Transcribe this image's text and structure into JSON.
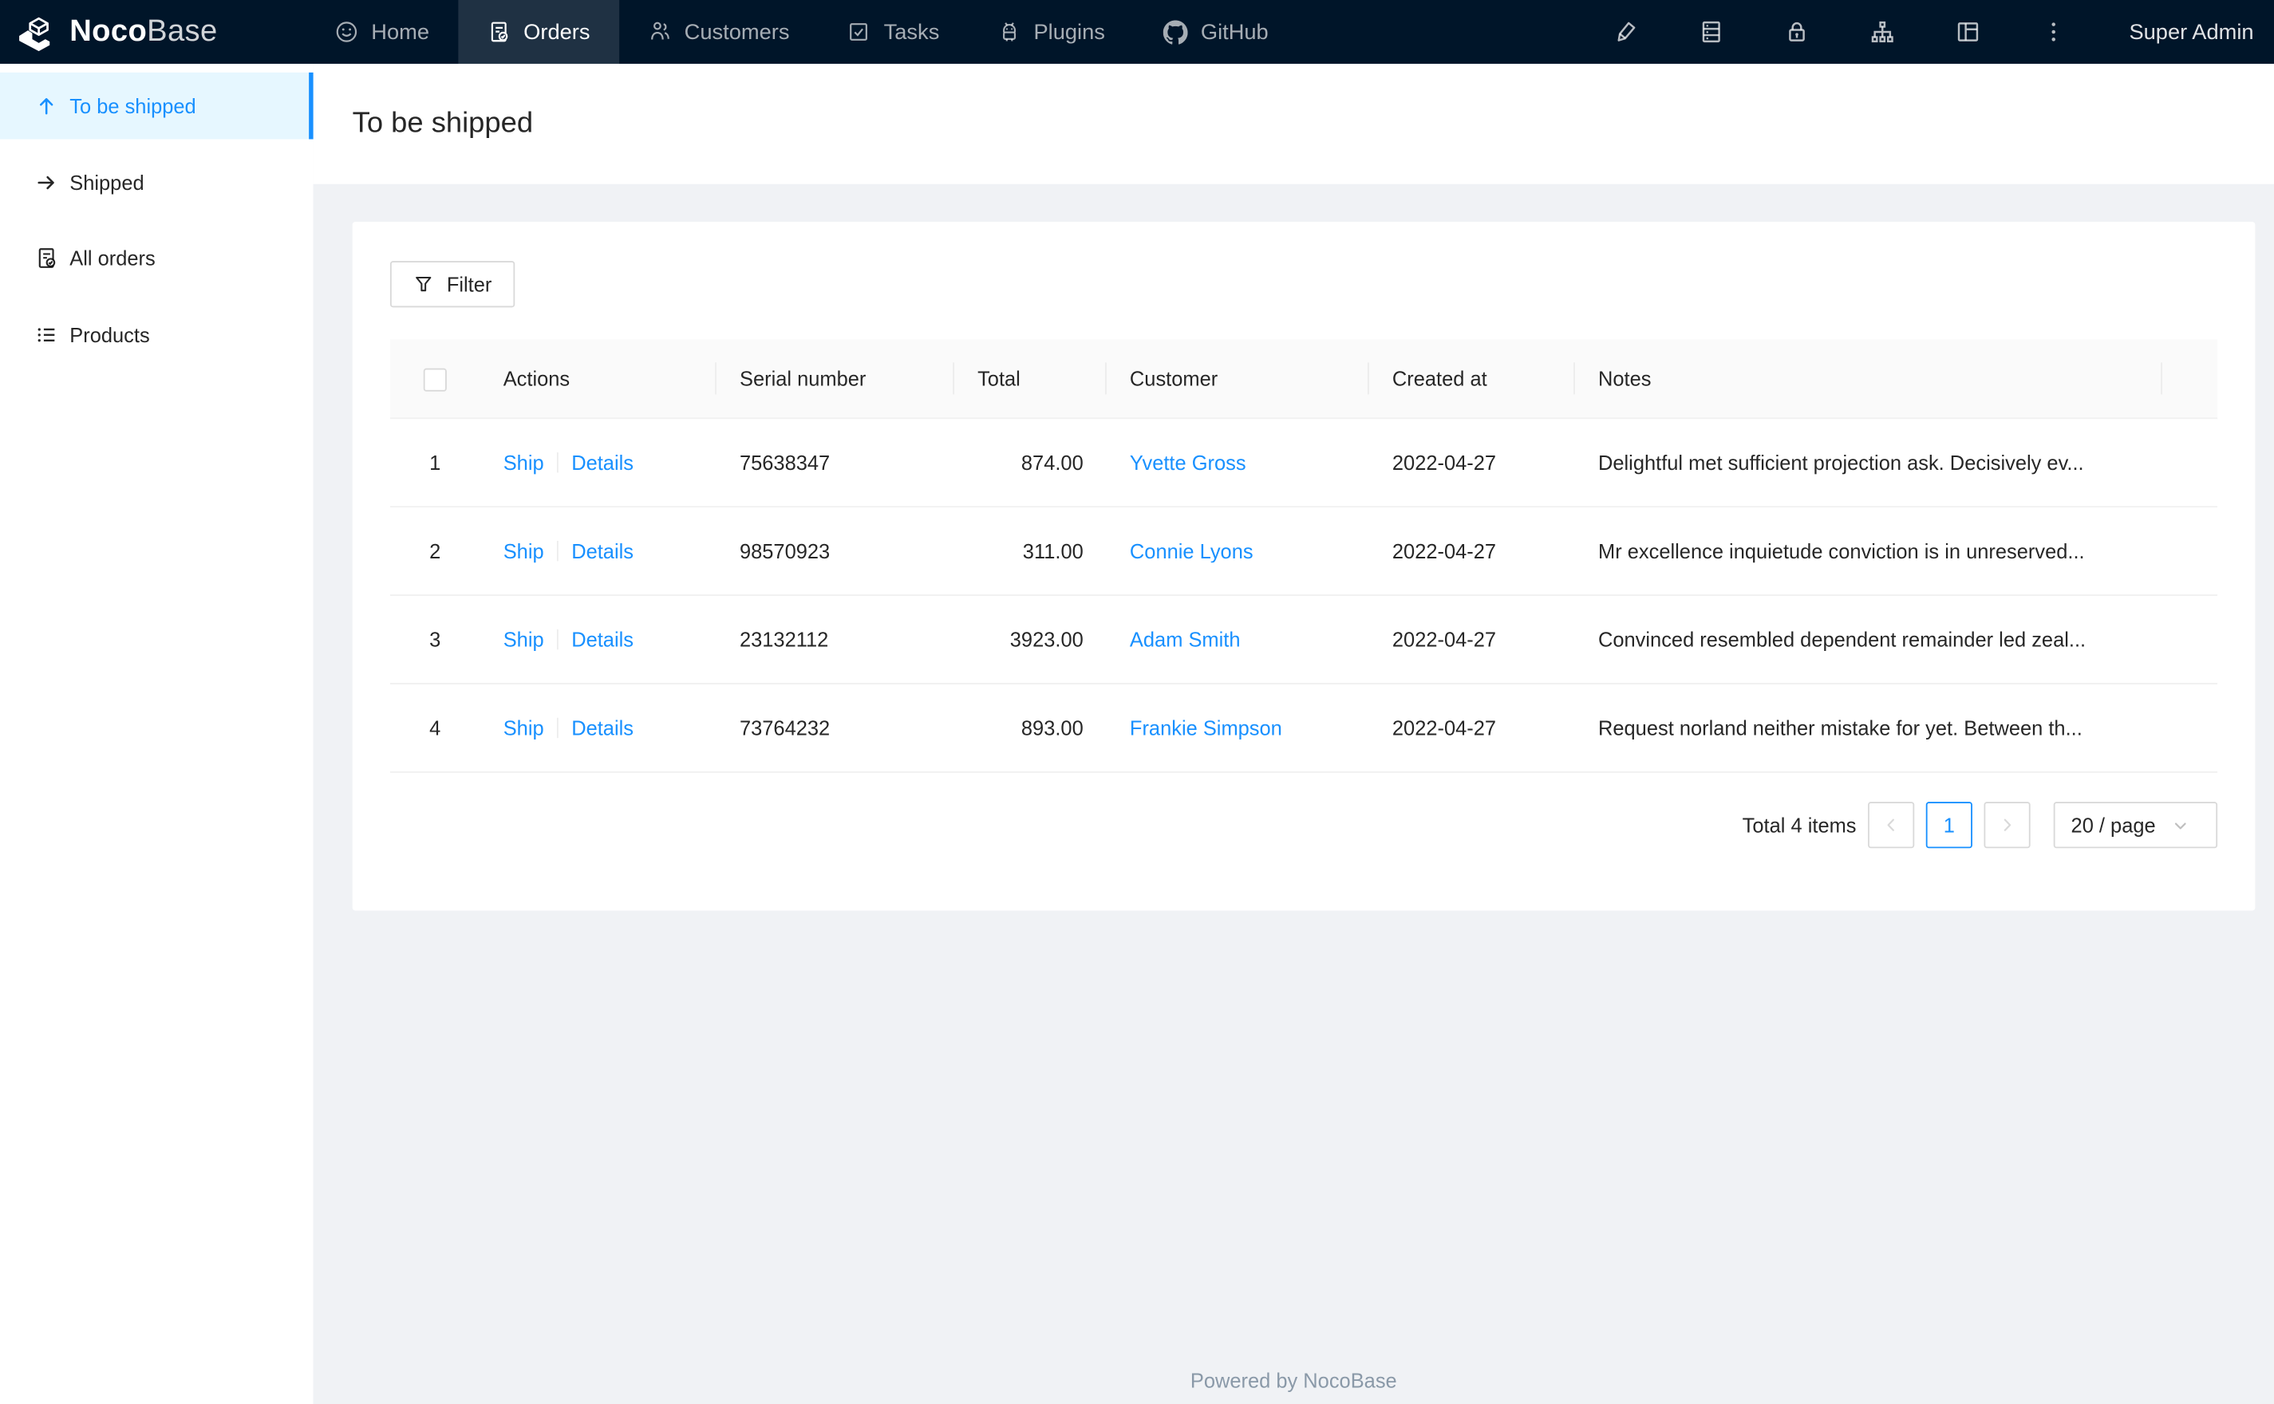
{
  "navbar": {
    "logo": {
      "part_bold": "Noco",
      "part_light": "Base"
    },
    "items": [
      {
        "label": "Home",
        "icon": "smile-icon",
        "active": false
      },
      {
        "label": "Orders",
        "icon": "order-file-icon",
        "active": true
      },
      {
        "label": "Customers",
        "icon": "team-icon",
        "active": false
      },
      {
        "label": "Tasks",
        "icon": "check-square-icon",
        "active": false
      },
      {
        "label": "Plugins",
        "icon": "android-icon",
        "active": false
      },
      {
        "label": "GitHub",
        "icon": "github-icon",
        "active": false
      }
    ],
    "tools": [
      "highlighter-icon",
      "database-icon",
      "lock-icon",
      "apartment-icon",
      "layout-icon",
      "kebab-icon"
    ],
    "user_label": "Super Admin"
  },
  "sidebar": {
    "items": [
      {
        "label": "To be shipped",
        "icon": "arrow-up-icon",
        "active": true
      },
      {
        "label": "Shipped",
        "icon": "arrow-right-icon",
        "active": false
      },
      {
        "label": "All orders",
        "icon": "file-done-icon",
        "active": false
      },
      {
        "label": "Products",
        "icon": "unordered-list-icon",
        "active": false
      }
    ]
  },
  "page": {
    "title": "To be shipped",
    "footer_text": "Powered by NocoBase"
  },
  "card": {
    "filter_label": "Filter",
    "table": {
      "columns": [
        "Actions",
        "Serial number",
        "Total",
        "Customer",
        "Created at",
        "Notes"
      ],
      "rows": [
        {
          "index": "1",
          "ship": "Ship",
          "details": "Details",
          "serial": "75638347",
          "total": "874.00",
          "customer": "Yvette Gross",
          "created_at": "2022-04-27",
          "notes": "Delightful met sufficient projection ask. Decisively ev..."
        },
        {
          "index": "2",
          "ship": "Ship",
          "details": "Details",
          "serial": "98570923",
          "total": "311.00",
          "customer": "Connie Lyons",
          "created_at": "2022-04-27",
          "notes": "Mr excellence inquietude conviction is in unreserved..."
        },
        {
          "index": "3",
          "ship": "Ship",
          "details": "Details",
          "serial": "23132112",
          "total": "3923.00",
          "customer": "Adam Smith",
          "created_at": "2022-04-27",
          "notes": "Convinced resembled dependent remainder led zeal..."
        },
        {
          "index": "4",
          "ship": "Ship",
          "details": "Details",
          "serial": "73764232",
          "total": "893.00",
          "customer": "Frankie Simpson",
          "created_at": "2022-04-27",
          "notes": "Request norland neither mistake for yet. Between th..."
        }
      ]
    },
    "pagination": {
      "total_text": "Total 4 items",
      "current_page": "1",
      "page_size_label": "20 / page"
    }
  },
  "colors": {
    "accent": "#1890ff",
    "navbar_bg": "#001529",
    "navbar_active_bg": "#20314a",
    "sidebar_active_bg": "#e6f7ff",
    "content_bg": "#f0f2f5",
    "link": "#1890ff",
    "table_header_bg": "#fafafa",
    "border": "#f0f0f0"
  }
}
